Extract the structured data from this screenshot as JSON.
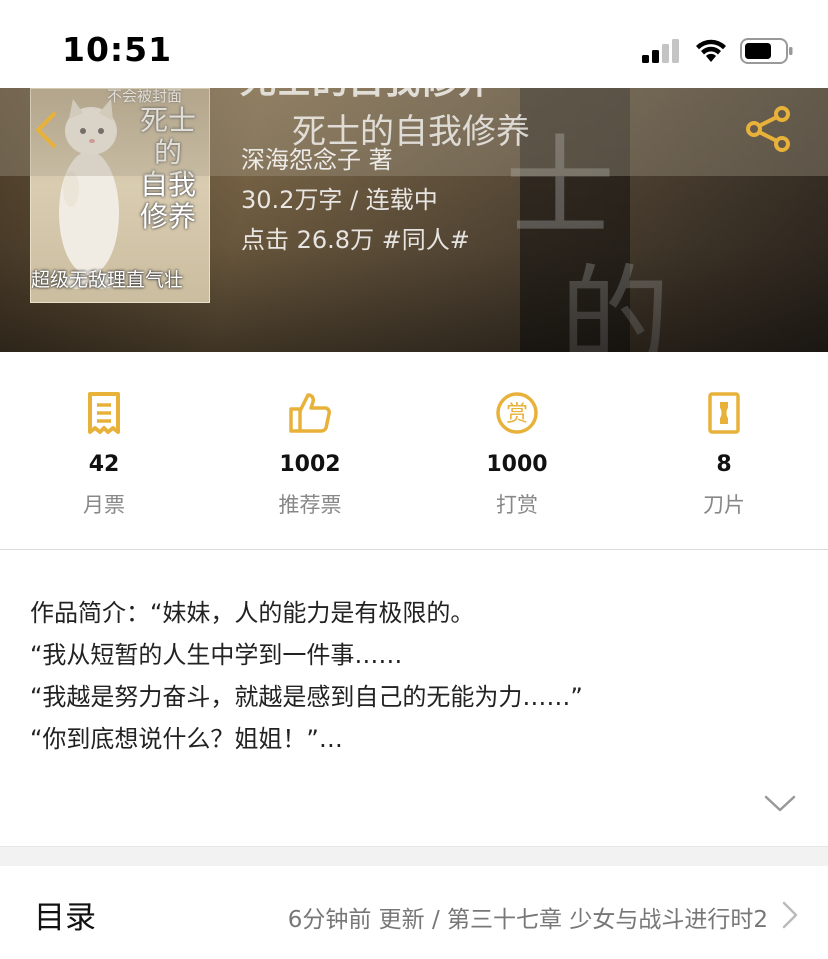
{
  "status_bar": {
    "time": "10:51"
  },
  "header": {
    "book_title": "死士的自我修养",
    "author": "深海怨念子 著",
    "word_count_status": "30.2万字 / 连载中",
    "clicks_tag": "点击 26.8万 #同人#"
  },
  "cover": {
    "top_text": "不会被封面",
    "title_lines": [
      "死士",
      "的",
      "自我",
      "修养"
    ],
    "bottom_text": "超级无敌理直气壮"
  },
  "stats": [
    {
      "value": "42",
      "label": "月票",
      "icon": "ticket-icon"
    },
    {
      "value": "1002",
      "label": "推荐票",
      "icon": "thumbs-up-icon"
    },
    {
      "value": "1000",
      "label": "打赏",
      "icon": "reward-coin-icon"
    },
    {
      "value": "8",
      "label": "刀片",
      "icon": "blade-icon"
    }
  ],
  "intro": {
    "lines": [
      "作品简介：“妹妹，人的能力是有极限的。",
      "“我从短暂的人生中学到一件事……",
      "“我越是努力奋斗，就越是感到自己的无能为力……”",
      "“你到底想说什么？姐姐！”…"
    ]
  },
  "toc": {
    "label": "目录",
    "update_text": "6分钟前 更新 / 第三十七章 少女与战斗进行时2"
  },
  "colors": {
    "accent": "#e8b23a",
    "text": "#222222",
    "muted": "#888888"
  }
}
